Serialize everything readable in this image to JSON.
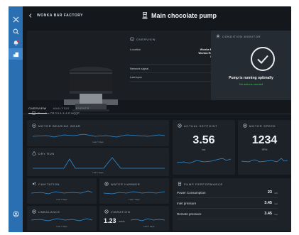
{
  "sidebar": {
    "items": [
      {
        "icon": "tools-icon",
        "active": false
      },
      {
        "icon": "search-icon",
        "active": false
      },
      {
        "icon": "alert-bell-icon",
        "active": false
      },
      {
        "icon": "dashboard-icon",
        "active": true
      }
    ],
    "bottom_icon": "user-icon"
  },
  "header": {
    "back_label": "WONKA BAR FACTORY",
    "title": "Main chocolate pump"
  },
  "pump": {
    "model": "Grundfos CR 3-5 A-A-A-E-HQQE"
  },
  "overview": {
    "title": "OVERVIEW",
    "rows": [
      {
        "label": "Location",
        "value": "Wonka Bar Factory\nWonka Road 1, 8850\nBjerringbro"
      },
      {
        "label": "Network signal",
        "value": ""
      },
      {
        "label": "Last sync",
        "value": "23 min ago"
      }
    ]
  },
  "condition_monitor": {
    "title": "CONDITION MONITOR",
    "status": "Pump is running optimally",
    "substatus": "No actions needed"
  },
  "tabs": [
    {
      "label": "OVERVIEW",
      "active": true
    },
    {
      "label": "ANALYSIS",
      "active": false
    },
    {
      "label": "EVENTS",
      "active": false
    }
  ],
  "widgets": {
    "bearing_wear": {
      "title": "MOTOR BEARING WEAR",
      "footer": "Last 7 days"
    },
    "dry_run": {
      "title": "DRY RUN",
      "footer": "Last 7 days"
    },
    "cavitation": {
      "title": "CAVITATION",
      "footer": "Last 7 days"
    },
    "water_hammer": {
      "title": "WATER HAMMER",
      "footer": "Last 7 days"
    },
    "unbalance": {
      "title": "UNBALANCE",
      "footer": "Last 7 days"
    },
    "vibration": {
      "title": "VIBRATION",
      "value": "1.23",
      "unit": "mm/s",
      "footer": "Last 7 days"
    },
    "setpoint": {
      "title": "ACTUAL SETPOINT",
      "value": "3.56",
      "unit": "bar"
    },
    "motor_speed": {
      "title": "MOTOR SPEED",
      "value": "1234",
      "unit": "RPM"
    }
  },
  "performance": {
    "title": "PUMP PERFORMANCE",
    "rows": [
      {
        "label": "Power Consumption",
        "value": "23",
        "unit": "kW"
      },
      {
        "label": "Inlet pressure",
        "value": "3.45",
        "unit": "bar"
      },
      {
        "label": "Remote pressure",
        "value": "3.45",
        "unit": "bar"
      }
    ]
  },
  "colors": {
    "sidebar": "#2b6fb3",
    "background": "#14181d",
    "card": "#1d2228",
    "spark": "#2f8fd8",
    "ok": "#3fc44a"
  }
}
